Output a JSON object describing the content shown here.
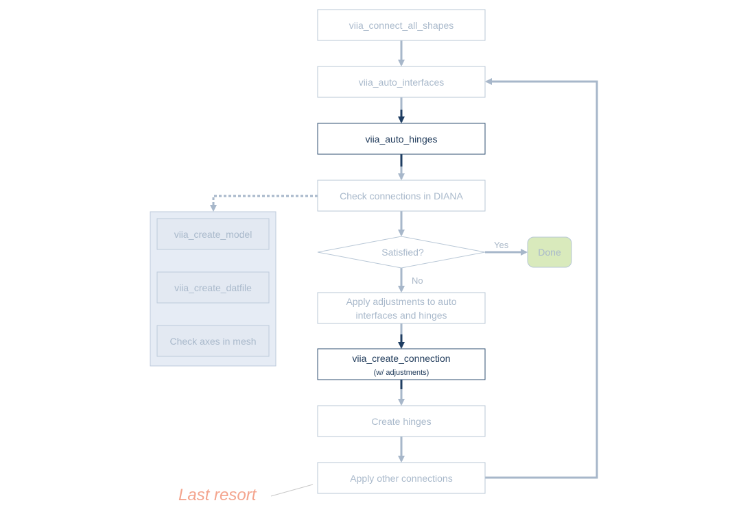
{
  "colors": {
    "faded_stroke": "#b8c7d6",
    "faded_text": "#a9b9cb",
    "active_stroke": "#2f4f71",
    "active_text": "#1f3a5a",
    "arrow_faded": "#a7b7ca",
    "arrow_active": "#1e3d62",
    "group_fill": "#e6ecf5",
    "group_stroke": "#bccadb",
    "done_fill": "#d9eabc",
    "done_stroke": "#b7c7d6",
    "annotation": "#f4a58e"
  },
  "nodes": {
    "connect_all_shapes": {
      "label": "viia_connect_all_shapes",
      "state": "faded"
    },
    "auto_interfaces": {
      "label": "viia_auto_interfaces",
      "state": "faded"
    },
    "auto_hinges": {
      "label": "viia_auto_hinges",
      "state": "active"
    },
    "check_connections": {
      "label": "Check connections in DIANA",
      "state": "faded"
    },
    "satisfied": {
      "label": "Satisfied?",
      "state": "faded"
    },
    "done": {
      "label": "Done",
      "state": "faded"
    },
    "apply_adjustments": {
      "line1": "Apply adjustments to auto",
      "line2": "interfaces and hinges",
      "state": "faded"
    },
    "create_connection": {
      "label": "viia_create_connection",
      "sublabel": "(w/ adjustments)",
      "state": "active"
    },
    "create_hinges": {
      "label": "Create hinges",
      "state": "faded"
    },
    "apply_other": {
      "label": "Apply other connections",
      "state": "faded"
    }
  },
  "side_group": {
    "items": [
      {
        "label": "viia_create_model"
      },
      {
        "label": "viia_create_datfile"
      },
      {
        "label": "Check axes in mesh"
      }
    ]
  },
  "edge_labels": {
    "yes": "Yes",
    "no": "No"
  },
  "annotation": {
    "text": "Last resort"
  }
}
